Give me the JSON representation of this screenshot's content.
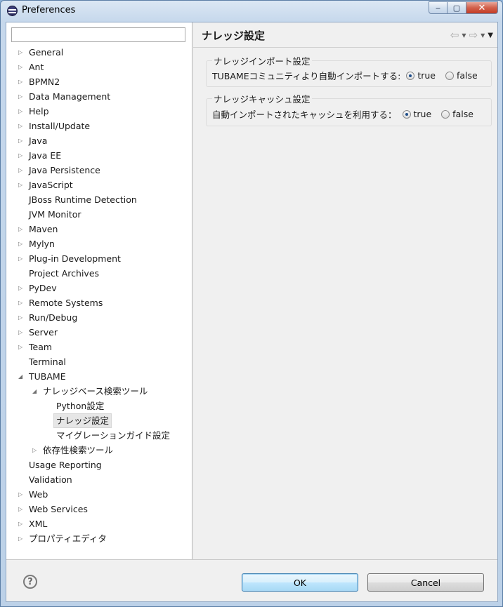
{
  "window": {
    "title": "Preferences",
    "controls": {
      "minimize": "‒",
      "maximize": "▢",
      "close": "✕"
    }
  },
  "filter": {
    "value": "",
    "placeholder": ""
  },
  "tree": [
    {
      "label": "General",
      "depth": 0,
      "arrow": "collapsed"
    },
    {
      "label": "Ant",
      "depth": 0,
      "arrow": "collapsed"
    },
    {
      "label": "BPMN2",
      "depth": 0,
      "arrow": "collapsed"
    },
    {
      "label": "Data Management",
      "depth": 0,
      "arrow": "collapsed"
    },
    {
      "label": "Help",
      "depth": 0,
      "arrow": "collapsed"
    },
    {
      "label": "Install/Update",
      "depth": 0,
      "arrow": "collapsed"
    },
    {
      "label": "Java",
      "depth": 0,
      "arrow": "collapsed"
    },
    {
      "label": "Java EE",
      "depth": 0,
      "arrow": "collapsed"
    },
    {
      "label": "Java Persistence",
      "depth": 0,
      "arrow": "collapsed"
    },
    {
      "label": "JavaScript",
      "depth": 0,
      "arrow": "collapsed"
    },
    {
      "label": "JBoss Runtime Detection",
      "depth": 0,
      "arrow": "none"
    },
    {
      "label": "JVM Monitor",
      "depth": 0,
      "arrow": "none"
    },
    {
      "label": "Maven",
      "depth": 0,
      "arrow": "collapsed"
    },
    {
      "label": "Mylyn",
      "depth": 0,
      "arrow": "collapsed"
    },
    {
      "label": "Plug-in Development",
      "depth": 0,
      "arrow": "collapsed"
    },
    {
      "label": "Project Archives",
      "depth": 0,
      "arrow": "none"
    },
    {
      "label": "PyDev",
      "depth": 0,
      "arrow": "collapsed"
    },
    {
      "label": "Remote Systems",
      "depth": 0,
      "arrow": "collapsed"
    },
    {
      "label": "Run/Debug",
      "depth": 0,
      "arrow": "collapsed"
    },
    {
      "label": "Server",
      "depth": 0,
      "arrow": "collapsed"
    },
    {
      "label": "Team",
      "depth": 0,
      "arrow": "collapsed"
    },
    {
      "label": "Terminal",
      "depth": 0,
      "arrow": "none"
    },
    {
      "label": "TUBAME",
      "depth": 0,
      "arrow": "expanded"
    },
    {
      "label": "ナレッジベース検索ツール",
      "depth": 1,
      "arrow": "expanded"
    },
    {
      "label": "Python設定",
      "depth": 2,
      "arrow": "none"
    },
    {
      "label": "ナレッジ設定",
      "depth": 2,
      "arrow": "none",
      "selected": true
    },
    {
      "label": "マイグレーションガイド設定",
      "depth": 2,
      "arrow": "none"
    },
    {
      "label": "依存性検索ツール",
      "depth": 1,
      "arrow": "collapsed"
    },
    {
      "label": "Usage Reporting",
      "depth": 0,
      "arrow": "none"
    },
    {
      "label": "Validation",
      "depth": 0,
      "arrow": "none"
    },
    {
      "label": "Web",
      "depth": 0,
      "arrow": "collapsed"
    },
    {
      "label": "Web Services",
      "depth": 0,
      "arrow": "collapsed"
    },
    {
      "label": "XML",
      "depth": 0,
      "arrow": "collapsed"
    },
    {
      "label": "プロパティエディタ",
      "depth": 0,
      "arrow": "collapsed"
    }
  ],
  "page": {
    "title": "ナレッジ設定",
    "nav": {
      "back": "⇦",
      "forward": "⇨",
      "dropdown": "▼",
      "menu": "▼"
    },
    "groups": [
      {
        "title": "ナレッジインポート設定",
        "label": "TUBAMEコミュニティより自動インポートする:",
        "options": [
          "true",
          "false"
        ],
        "selected": "true"
      },
      {
        "title": "ナレッジキャッシュ設定",
        "label": "自動インポートされたキャッシュを利用する：",
        "options": [
          "true",
          "false"
        ],
        "selected": "true"
      }
    ]
  },
  "footer": {
    "help": "?",
    "ok": "OK",
    "cancel": "Cancel"
  }
}
